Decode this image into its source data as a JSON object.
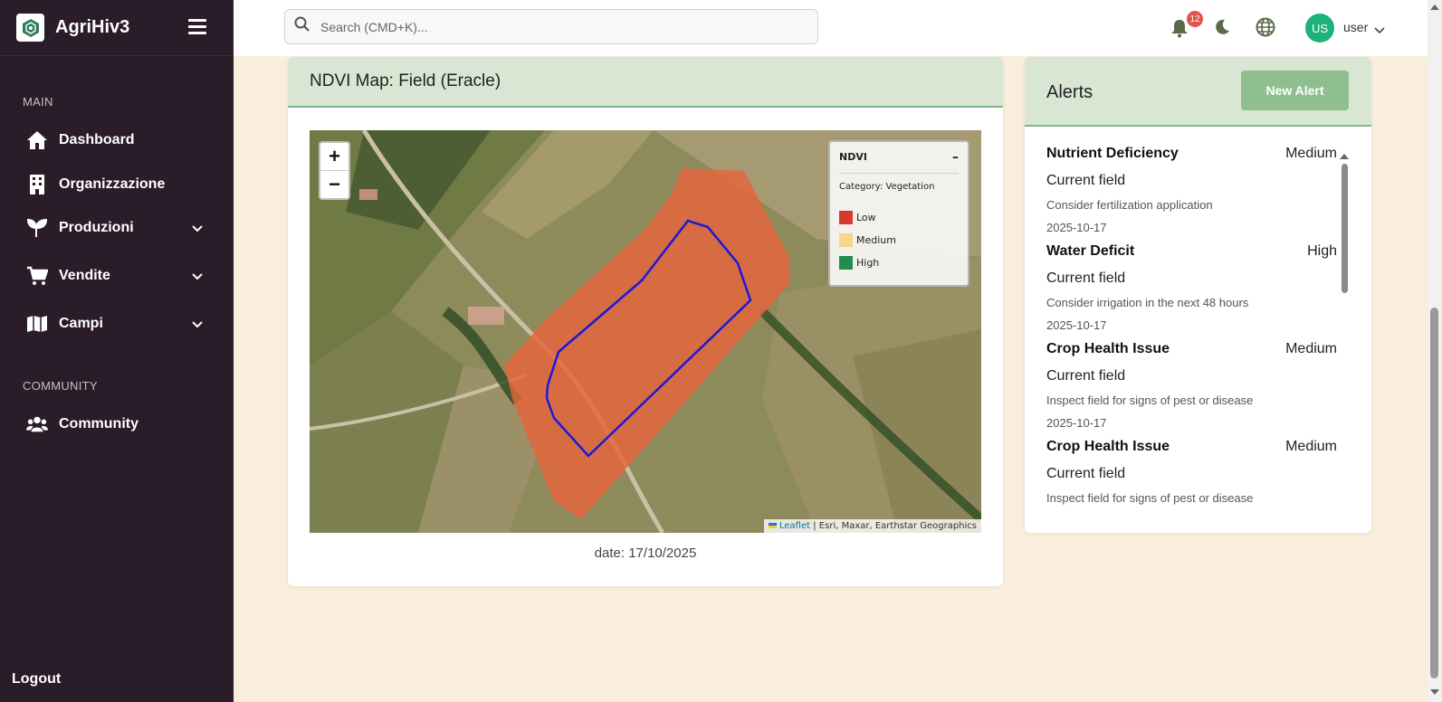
{
  "app": {
    "name": "AgriHiv3"
  },
  "sidebar": {
    "main_label": "MAIN",
    "items": [
      {
        "label": "Dashboard",
        "icon": "home-icon"
      },
      {
        "label": "Organizzazione",
        "icon": "building-icon"
      },
      {
        "label": "Produzioni",
        "icon": "seedling-icon",
        "expandable": true
      },
      {
        "label": "Vendite",
        "icon": "cart-icon",
        "expandable": true
      },
      {
        "label": "Campi",
        "icon": "map-icon",
        "expandable": true
      }
    ],
    "community_label": "COMMUNITY",
    "community_item": {
      "label": "Community",
      "icon": "users-icon"
    },
    "logout_label": "Logout"
  },
  "topbar": {
    "search_placeholder": "Search (CMD+K)...",
    "notification_count": "12",
    "avatar_initials": "US",
    "user_name": "user"
  },
  "ndvi": {
    "title": "NDVI Map: Field (Eracle)",
    "zoom_in": "+",
    "zoom_out": "−",
    "legend": {
      "title": "NDVI",
      "collapse": "–",
      "category": "Category: Vegetation",
      "items": [
        {
          "label": "Low",
          "color": "#d63a2f"
        },
        {
          "label": "Medium",
          "color": "#f5d68a"
        },
        {
          "label": "High",
          "color": "#1f8f4e"
        }
      ]
    },
    "attribution_link": "Leaflet",
    "attribution_text": "| Esri, Maxar, Earthstar Geographics",
    "date": "date: 17/10/2025"
  },
  "alerts": {
    "title": "Alerts",
    "new_button": "New Alert",
    "items": [
      {
        "type": "Nutrient Deficiency",
        "severity": "Medium",
        "field": "Current field",
        "recommendation": "Consider fertilization application",
        "date": "2025-10-17"
      },
      {
        "type": "Water Deficit",
        "severity": "High",
        "field": "Current field",
        "recommendation": "Consider irrigation in the next 48 hours",
        "date": "2025-10-17"
      },
      {
        "type": "Crop Health Issue",
        "severity": "Medium",
        "field": "Current field",
        "recommendation": "Inspect field for signs of pest or disease",
        "date": "2025-10-17"
      },
      {
        "type": "Crop Health Issue",
        "severity": "Medium",
        "field": "Current field",
        "recommendation": "Inspect field for signs of pest or disease",
        "date": ""
      }
    ]
  },
  "colors": {
    "sidebar_bg": "#2a1c28",
    "page_bg": "#f9eedc",
    "card_header_bg": "#d9e6d4",
    "accent_green": "#8fbf8f",
    "avatar_bg": "#1db27a",
    "badge_red": "#e0554a",
    "ndvi_overlay": "#e8643c",
    "field_outline": "#1a1ad6"
  }
}
